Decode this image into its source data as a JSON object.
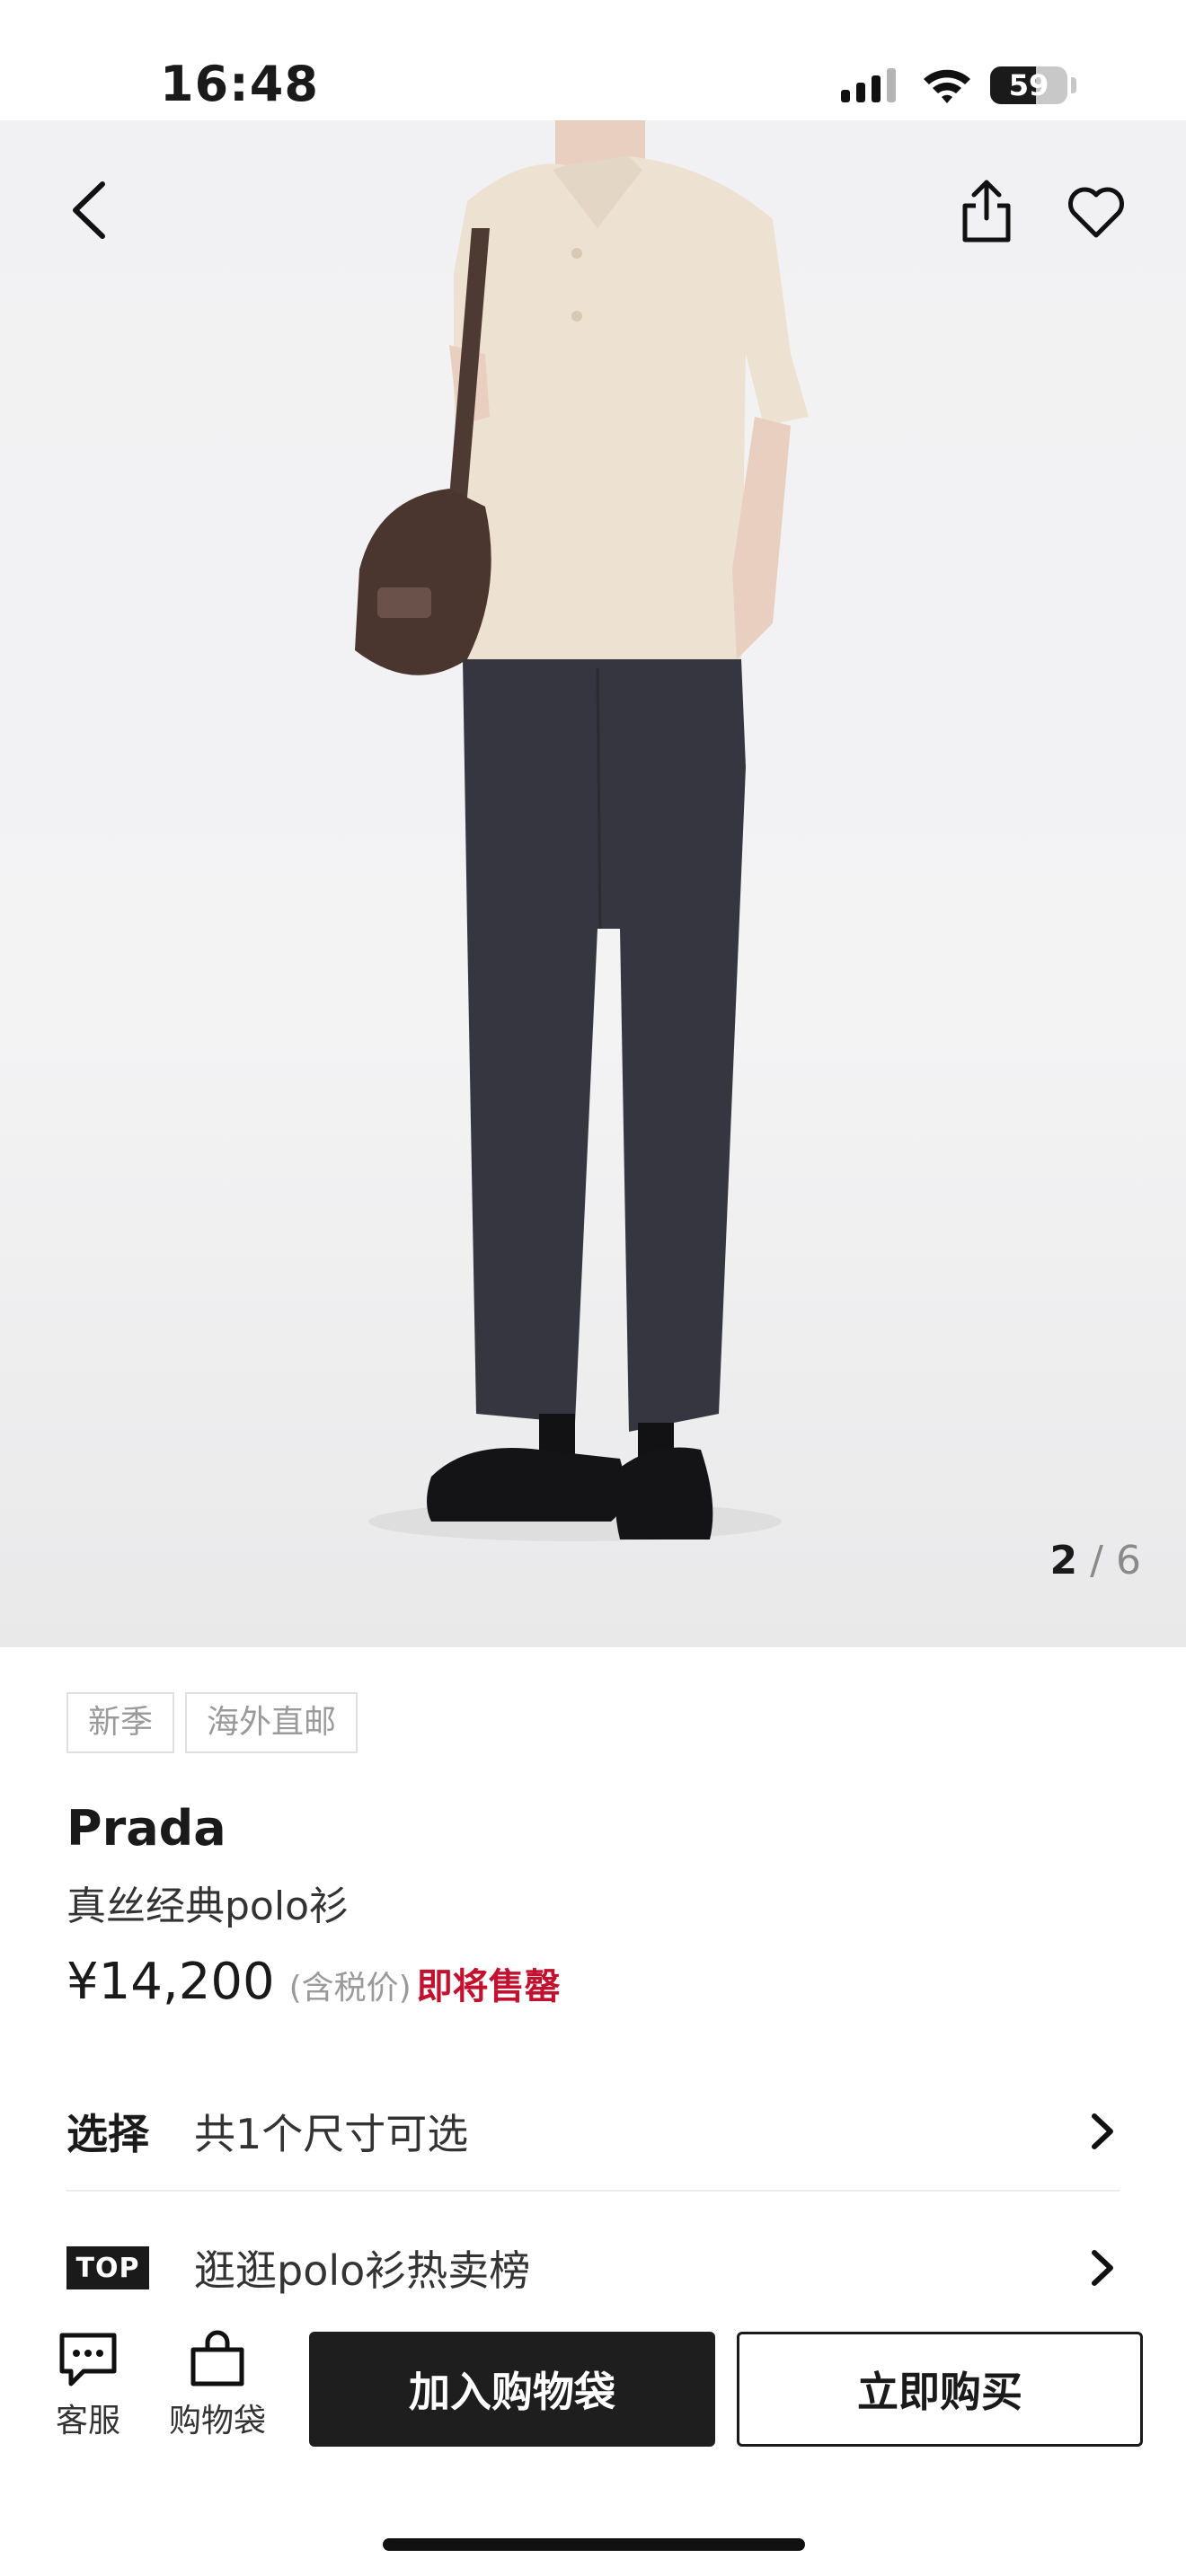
{
  "status_bar": {
    "time": "16:48",
    "battery_level": "59",
    "battery_fraction": 0.59
  },
  "gallery": {
    "current": "2",
    "separator": "/",
    "total": "6"
  },
  "product": {
    "tags": [
      "新季",
      "海外直邮"
    ],
    "brand": "Prada",
    "name": "真丝经典polo衫",
    "price": "¥14,200",
    "tax_note": "(含税价)",
    "stock_status": "即将售罄"
  },
  "size_row": {
    "label": "选择",
    "text": "共1个尺寸可选"
  },
  "ranking_row": {
    "badge": "TOP",
    "text": "逛逛polo衫热卖榜"
  },
  "bottom_bar": {
    "service_label": "客服",
    "bag_label": "购物袋",
    "add_to_bag_label": "加入购物袋",
    "buy_now_label": "立即购买"
  },
  "icons": [
    "back-icon",
    "share-icon",
    "heart-icon",
    "chat-icon",
    "shopping-bag-icon",
    "chevron-right-icon",
    "signal-icon",
    "wifi-icon",
    "battery-icon"
  ],
  "colors": {
    "accent_red": "#c3122f",
    "primary_button": "#1e1e1e"
  }
}
